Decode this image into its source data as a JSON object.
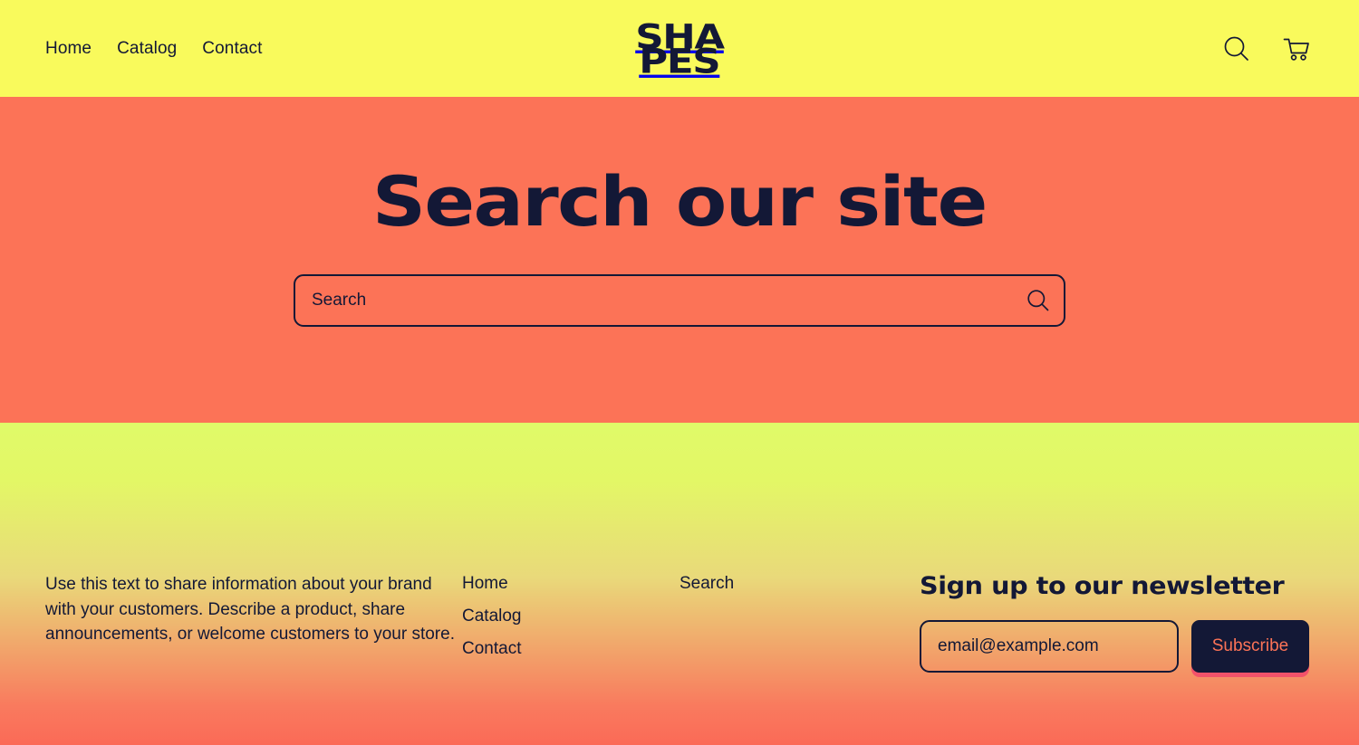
{
  "header": {
    "nav": [
      {
        "label": "Home"
      },
      {
        "label": "Catalog"
      },
      {
        "label": "Contact"
      }
    ],
    "logo": {
      "line1": "SHA",
      "line2": "PES"
    },
    "actions": {
      "search_icon": "search-icon",
      "cart_icon": "cart-icon"
    },
    "colors": {
      "background": "#f9fa5c",
      "text": "#131836"
    }
  },
  "hero": {
    "title": "Search our site",
    "search": {
      "placeholder": "Search",
      "value": "",
      "submit_icon": "search-icon"
    },
    "colors": {
      "background": "#fc7357",
      "text": "#131836"
    }
  },
  "footer": {
    "about_text": "Use this text to share information about your brand with your customers. Describe a product, share announcements, or welcome customers to your store.",
    "link_columns": [
      {
        "links": [
          {
            "label": "Home"
          },
          {
            "label": "Catalog"
          },
          {
            "label": "Contact"
          }
        ]
      },
      {
        "links": [
          {
            "label": "Search"
          }
        ]
      }
    ],
    "newsletter": {
      "title": "Sign up to our newsletter",
      "email_placeholder": "email@example.com",
      "email_value": "",
      "subscribe_label": "Subscribe"
    },
    "colors": {
      "gradient_top": "#e0fa69",
      "gradient_bottom": "#fb6a57",
      "text": "#131836",
      "button_background": "#131836",
      "button_text": "#fc7357",
      "button_shadow": "#f2526a"
    }
  }
}
